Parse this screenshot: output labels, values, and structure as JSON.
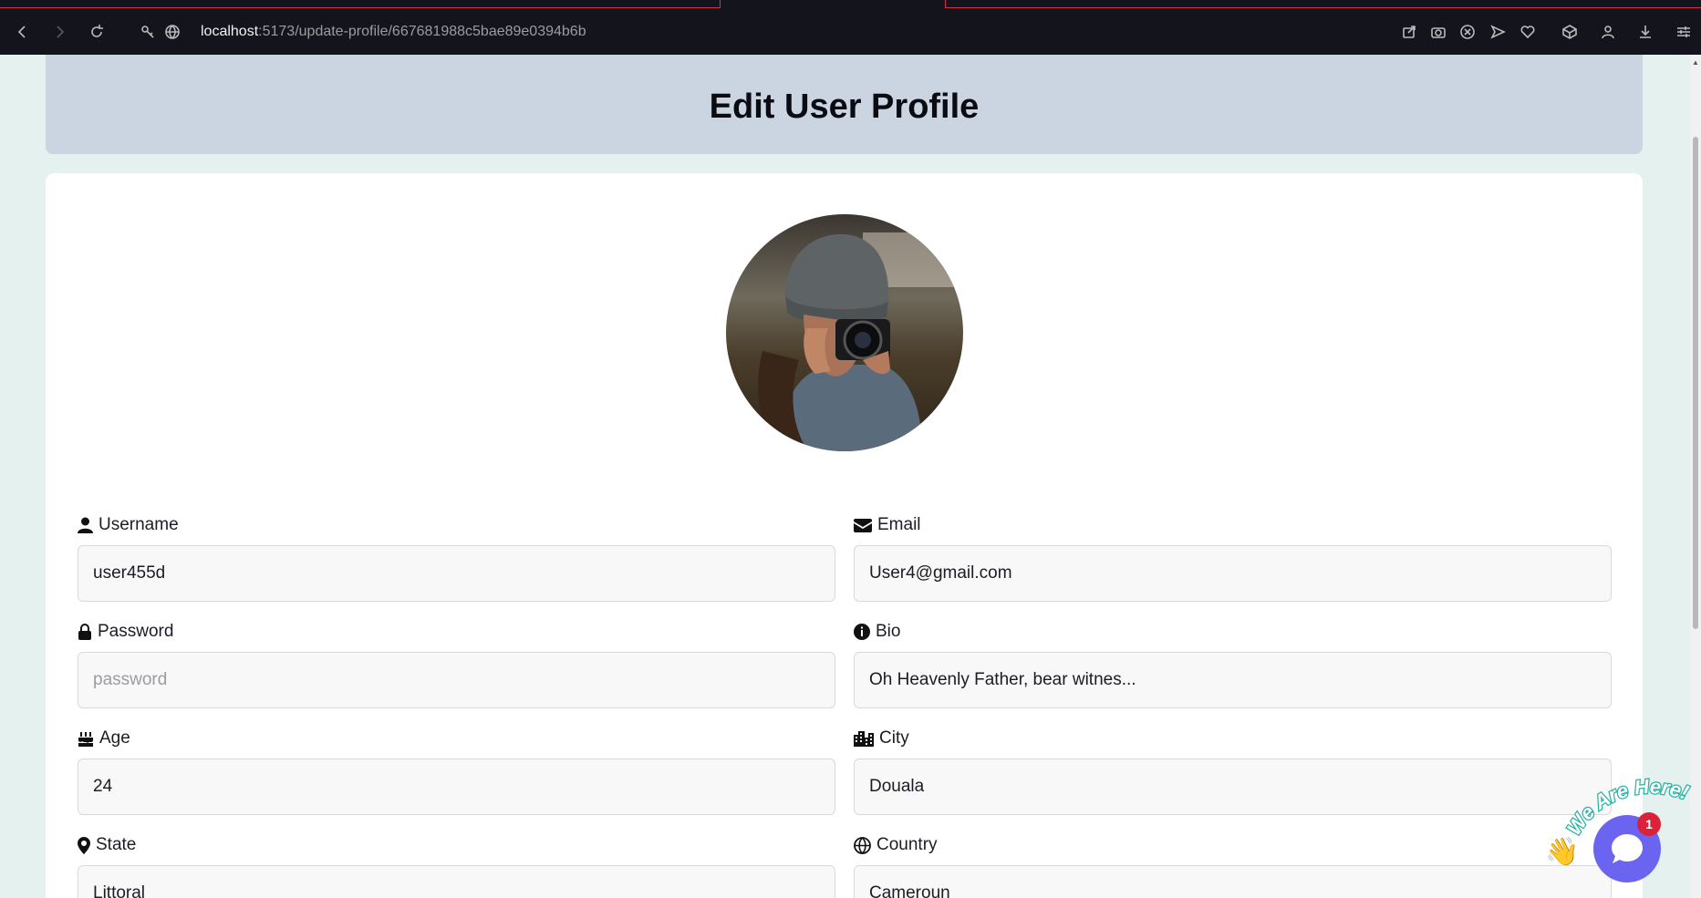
{
  "browser": {
    "url_host": "localhost",
    "url_path": ":5173/update-profile/667681988c5bae89e0394b6b"
  },
  "page": {
    "title": "Edit User Profile"
  },
  "fields": {
    "username": {
      "label": "Username",
      "value": "user455d"
    },
    "email": {
      "label": "Email",
      "value": "User4@gmail.com"
    },
    "password": {
      "label": "Password",
      "placeholder": "password"
    },
    "bio": {
      "label": "Bio",
      "value": "Oh Heavenly Father, bear witnes..."
    },
    "age": {
      "label": "Age",
      "value": "24"
    },
    "city": {
      "label": "City",
      "value": "Douala"
    },
    "state": {
      "label": "State",
      "value": "Littoral"
    },
    "country": {
      "label": "Country",
      "value": "Cameroun"
    }
  },
  "chat_widget": {
    "tagline": "We Are Here!",
    "unread_count": "1"
  },
  "colors": {
    "header_bg": "#cad5e1",
    "page_bg": "#e4f1ee",
    "chat_accent": "#6a64f0",
    "badge": "#d9233b"
  }
}
